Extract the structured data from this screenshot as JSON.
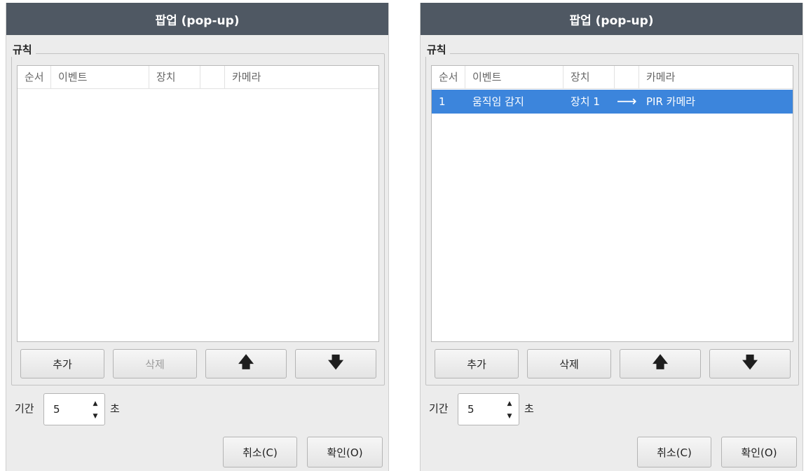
{
  "dialogs": [
    {
      "title": "팝업 (pop-up)",
      "group_title": "규칙",
      "columns": [
        "순서",
        "이벤트",
        "장치",
        "",
        "카메라"
      ],
      "rows": [],
      "buttons": {
        "add": "추가",
        "delete": "삭제",
        "up_icon": "🡅",
        "down_icon": "🡇",
        "delete_enabled": false
      },
      "duration": {
        "label": "기간",
        "value": "5",
        "unit": "초",
        "up_glyph": "▲",
        "down_glyph": "▼"
      },
      "footer": {
        "cancel": "취소(C)",
        "ok": "확인(O)"
      }
    },
    {
      "title": "팝업 (pop-up)",
      "group_title": "규칙",
      "columns": [
        "순서",
        "이벤트",
        "장치",
        "",
        "카메라"
      ],
      "rows": [
        {
          "order": "1",
          "event": "움직임 감지",
          "device": "장치 1",
          "arrow": "⟶",
          "camera": "PIR 카메라",
          "selected": true
        }
      ],
      "buttons": {
        "add": "추가",
        "delete": "삭제",
        "up_icon": "🡅",
        "down_icon": "🡇",
        "delete_enabled": true
      },
      "duration": {
        "label": "기간",
        "value": "5",
        "unit": "초",
        "up_glyph": "▲",
        "down_glyph": "▼"
      },
      "footer": {
        "cancel": "취소(C)",
        "ok": "확인(O)"
      }
    }
  ],
  "colors": {
    "titlebar": "#4f5863",
    "selection": "#3c85dc",
    "dialog_bg": "#ececec"
  }
}
